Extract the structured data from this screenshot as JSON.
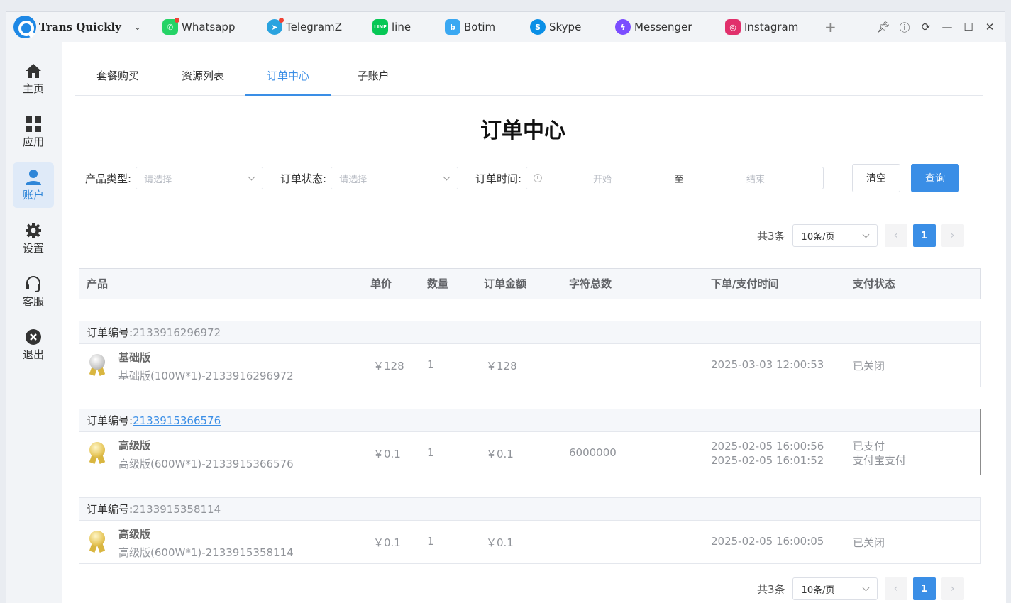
{
  "brand": {
    "name": "Trans Quickly"
  },
  "apps": [
    {
      "label": "Whatsapp",
      "icon": "whatsapp-icon",
      "color": "#25d366",
      "dot": true
    },
    {
      "label": "TelegramZ",
      "icon": "telegram-icon",
      "color": "#2aa3df",
      "dot": true
    },
    {
      "label": "line",
      "icon": "line-icon",
      "color": "#06c755",
      "dot": false
    },
    {
      "label": "Botim",
      "icon": "botim-icon",
      "color": "#3aa8f2",
      "dot": false
    },
    {
      "label": "Skype",
      "icon": "skype-icon",
      "color": "#0a8fe6",
      "dot": false
    },
    {
      "label": "Messenger",
      "icon": "messenger-icon",
      "color": "#7b4dff",
      "dot": false
    },
    {
      "label": "Instagram",
      "icon": "instagram-icon",
      "color": "#e1306c",
      "dot": false
    }
  ],
  "nav": [
    {
      "label": "主页",
      "icon": "home-icon",
      "active": false
    },
    {
      "label": "应用",
      "icon": "grid-icon",
      "active": false
    },
    {
      "label": "账户",
      "icon": "user-icon",
      "active": true
    },
    {
      "label": "设置",
      "icon": "gear-icon",
      "active": false
    },
    {
      "label": "客服",
      "icon": "headset-icon",
      "active": false
    },
    {
      "label": "退出",
      "icon": "close-circle-icon",
      "active": false
    }
  ],
  "subtabs": [
    {
      "label": "套餐购买",
      "active": false
    },
    {
      "label": "资源列表",
      "active": false
    },
    {
      "label": "订单中心",
      "active": true
    },
    {
      "label": "子账户",
      "active": false
    }
  ],
  "page": {
    "title": "订单中心"
  },
  "filters": {
    "product_type_label": "产品类型:",
    "product_type_placeholder": "请选择",
    "order_status_label": "订单状态:",
    "order_status_placeholder": "请选择",
    "order_time_label": "订单时间:",
    "start_placeholder": "开始",
    "range_separator": "至",
    "end_placeholder": "结束",
    "clear_label": "清空",
    "query_label": "查询"
  },
  "pagination": {
    "total": "共3条",
    "page_size": "10条/页",
    "current": "1"
  },
  "table": {
    "headers": {
      "product": "产品",
      "unit_price": "单价",
      "quantity": "数量",
      "amount": "订单金额",
      "chars": "字符总数",
      "time": "下单/支付时间",
      "status": "支付状态"
    },
    "order_no_label": "订单编号:",
    "orders": [
      {
        "id": "2133916296972",
        "name": "基础版",
        "desc": "基础版(100W*1)-2133916296972",
        "price": "￥128",
        "qty": "1",
        "amount": "￥128",
        "chars": "",
        "time1": "2025-03-03 12:00:53",
        "time2": "",
        "status1": "已关闭",
        "status2": "",
        "medal": "silver"
      },
      {
        "id": "2133915366576",
        "name": "高级版",
        "desc": "高级版(600W*1)-2133915366576",
        "price": "￥0.1",
        "qty": "1",
        "amount": "￥0.1",
        "chars": "6000000",
        "time1": "2025-02-05 16:00:56",
        "time2": "2025-02-05 16:01:52",
        "status1": "已支付",
        "status2": "支付宝支付",
        "medal": "gold"
      },
      {
        "id": "2133915358114",
        "name": "高级版",
        "desc": "高级版(600W*1)-2133915358114",
        "price": "￥0.1",
        "qty": "1",
        "amount": "￥0.1",
        "chars": "",
        "time1": "2025-02-05 16:00:05",
        "time2": "",
        "status1": "已关闭",
        "status2": "",
        "medal": "gold"
      }
    ]
  }
}
